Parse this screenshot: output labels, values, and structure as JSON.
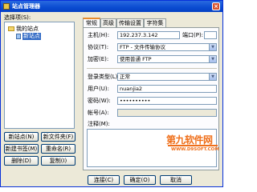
{
  "window": {
    "title": "站点管理器"
  },
  "left": {
    "label": "选择项(S):",
    "tree": [
      {
        "label": "我的站点",
        "type": "folder"
      },
      {
        "label": "新站点",
        "type": "site",
        "selected": true
      }
    ],
    "buttons": {
      "new_site": "新站点(N)",
      "new_folder": "新文件夹(F)",
      "new_bookmark": "新建书签(M)",
      "rename": "重命名(R)",
      "delete": "删除(D)",
      "copy": "复制(I)"
    }
  },
  "tabs": [
    "常规",
    "高级",
    "传输设置",
    "字符集"
  ],
  "general": {
    "host_label": "主机(H):",
    "host_value": "192.237.3.142",
    "port_label": "端口(P):",
    "port_value": "",
    "protocol_label": "协议(T):",
    "protocol_value": "FTP - 文件传输协议",
    "encryption_label": "加密(E):",
    "encryption_value": "使用普通 FTP",
    "logon_label": "登录类型(L):",
    "logon_value": "正常",
    "user_label": "用户(U):",
    "user_value": "nuanjia2",
    "password_label": "密码(W):",
    "password_value": "••••••••••",
    "account_label": "帐号(A):",
    "account_value": "",
    "comments_label": "注释(M):"
  },
  "footer": {
    "connect": "连接(C)",
    "ok": "确定(O)",
    "cancel": "取消"
  },
  "watermark": {
    "big": "第九软件网",
    "small": "WWW.D9SOFT.COM"
  },
  "colors": {
    "title_bar": "#0a4bd0",
    "selection": "#316ac5",
    "watermark": "#ef6f1a"
  }
}
